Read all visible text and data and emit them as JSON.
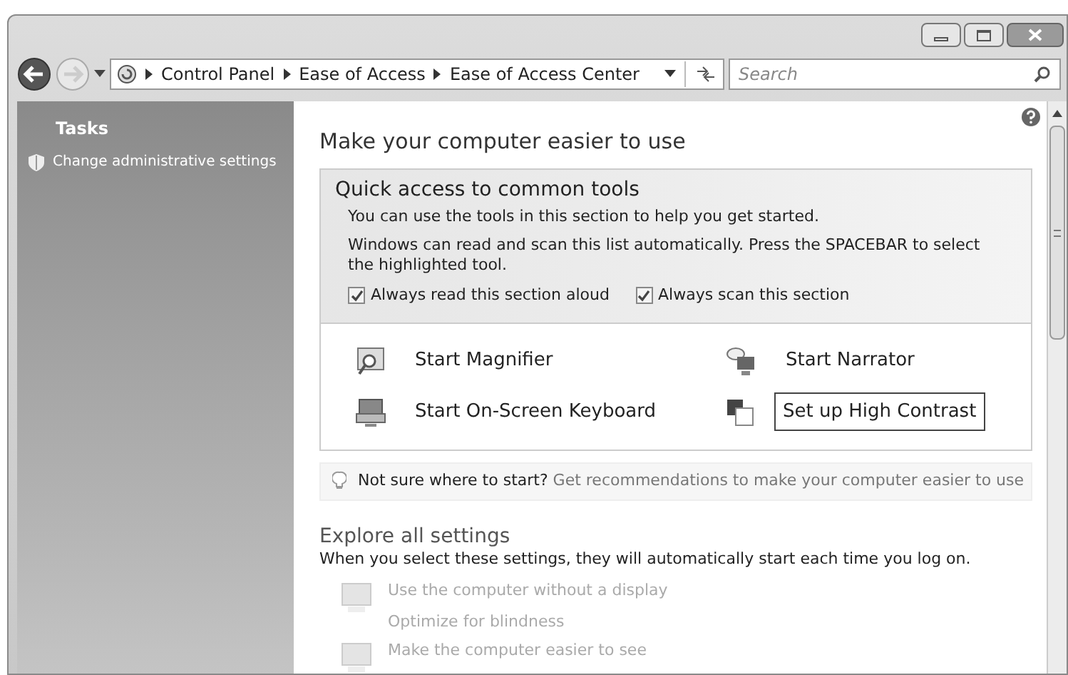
{
  "breadcrumb": [
    "Control Panel",
    "Ease of Access",
    "Ease of Access Center"
  ],
  "search": {
    "placeholder": "Search"
  },
  "sidebar": {
    "heading": "Tasks",
    "items": [
      {
        "label": "Change administrative settings"
      }
    ]
  },
  "main": {
    "title": "Make your computer easier to use",
    "quick_access": {
      "title": "Quick access to common tools",
      "description": "You can use the tools in this section to help you get started.",
      "note": "Windows can read and scan this list automatically.  Press the SPACEBAR to select the highlighted tool.",
      "options": [
        {
          "label": "Always read this section aloud",
          "checked": true
        },
        {
          "label": "Always scan this section",
          "checked": true
        }
      ],
      "tools": [
        {
          "label": "Start Magnifier",
          "kind": "magnifier",
          "selected": false
        },
        {
          "label": "Start Narrator",
          "kind": "narrator",
          "selected": false
        },
        {
          "label": "Start On-Screen Keyboard",
          "kind": "keyboard",
          "selected": false
        },
        {
          "label": "Set up High Contrast",
          "kind": "contrast",
          "selected": true
        }
      ]
    },
    "hint": {
      "question": "Not sure where to start?",
      "link": "Get recommendations to make your computer easier to use"
    },
    "explore": {
      "title": "Explore all settings",
      "description": "When you select these settings, they will automatically start each time you log on.",
      "items": [
        {
          "title": "Use the computer without a display",
          "subtitle": "Optimize for blindness"
        },
        {
          "title": "Make the computer easier to see"
        }
      ]
    }
  }
}
